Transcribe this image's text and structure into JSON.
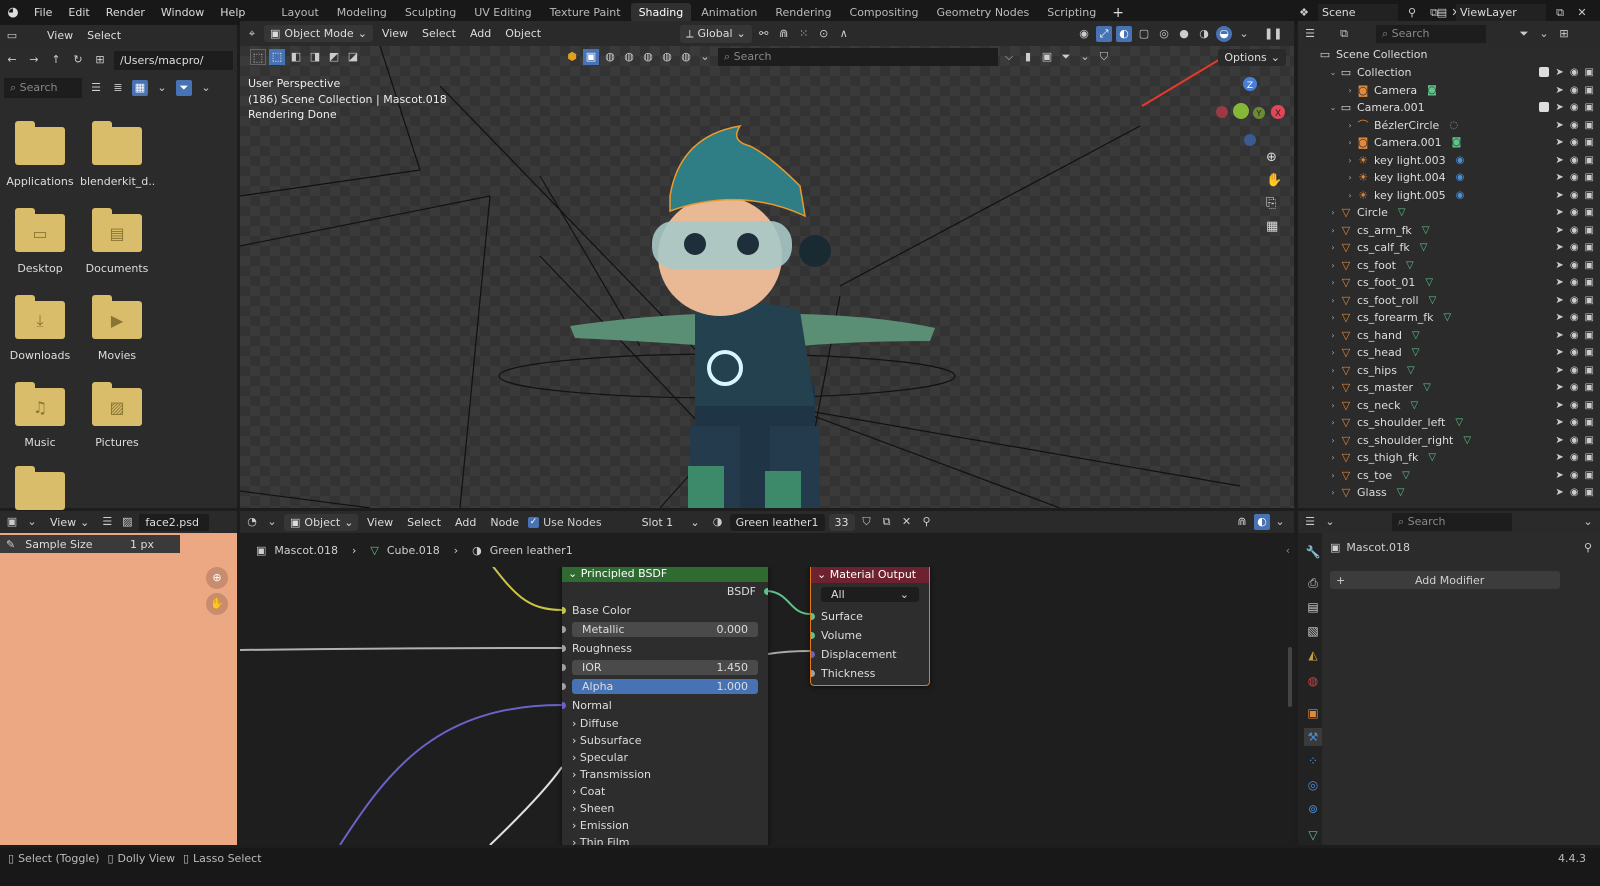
{
  "menu": {
    "file": "File",
    "edit": "Edit",
    "render": "Render",
    "window": "Window",
    "help": "Help"
  },
  "workspaces": [
    "Layout",
    "Modeling",
    "Sculpting",
    "UV Editing",
    "Texture Paint",
    "Shading",
    "Animation",
    "Rendering",
    "Compositing",
    "Geometry Nodes",
    "Scripting"
  ],
  "active_workspace": "Shading",
  "scene": {
    "name": "Scene",
    "view_layer": "ViewLayer"
  },
  "file_browser": {
    "view": "View",
    "select": "Select",
    "path": "/Users/macpro/",
    "search_placeholder": "Search",
    "items": [
      {
        "label": "Applications",
        "icon": "folder"
      },
      {
        "label": "blenderkit_d...",
        "icon": "folder"
      },
      {
        "label": "Desktop",
        "icon": "desktop"
      },
      {
        "label": "Documents",
        "icon": "documents"
      },
      {
        "label": "Downloads",
        "icon": "download"
      },
      {
        "label": "Movies",
        "icon": "film"
      },
      {
        "label": "Music",
        "icon": "music"
      },
      {
        "label": "Pictures",
        "icon": "picture"
      }
    ]
  },
  "viewport": {
    "mode": "Object Mode",
    "view": "View",
    "select": "Select",
    "add": "Add",
    "object": "Object",
    "transform": "Global",
    "search_placeholder": "Search",
    "options": "Options",
    "overlay_line1": "User Perspective",
    "overlay_line2": "(186) Scene Collection | Mascot.018",
    "overlay_line3": "Rendering Done",
    "gizmo": {
      "z": "Z",
      "y": "Y",
      "x": "X"
    }
  },
  "outliner": {
    "search_placeholder": "Search",
    "root": "Scene Collection",
    "rows": [
      {
        "name": "Collection",
        "indent": 1,
        "type": "collection"
      },
      {
        "name": "Camera",
        "indent": 2,
        "type": "camera"
      },
      {
        "name": "Camera.001",
        "indent": 1,
        "type": "collection"
      },
      {
        "name": "BézlerCircle",
        "indent": 2,
        "type": "curve"
      },
      {
        "name": "Camera.001",
        "indent": 2,
        "type": "camera"
      },
      {
        "name": "key light.003",
        "indent": 2,
        "type": "light"
      },
      {
        "name": "key light.004",
        "indent": 2,
        "type": "light"
      },
      {
        "name": "key light.005",
        "indent": 2,
        "type": "light"
      },
      {
        "name": "Circle",
        "indent": 1,
        "type": "mesh"
      },
      {
        "name": "cs_arm_fk",
        "indent": 1,
        "type": "mesh"
      },
      {
        "name": "cs_calf_fk",
        "indent": 1,
        "type": "mesh"
      },
      {
        "name": "cs_foot",
        "indent": 1,
        "type": "mesh"
      },
      {
        "name": "cs_foot_01",
        "indent": 1,
        "type": "mesh"
      },
      {
        "name": "cs_foot_roll",
        "indent": 1,
        "type": "mesh"
      },
      {
        "name": "cs_forearm_fk",
        "indent": 1,
        "type": "mesh"
      },
      {
        "name": "cs_hand",
        "indent": 1,
        "type": "mesh"
      },
      {
        "name": "cs_head",
        "indent": 1,
        "type": "mesh"
      },
      {
        "name": "cs_hips",
        "indent": 1,
        "type": "mesh"
      },
      {
        "name": "cs_master",
        "indent": 1,
        "type": "mesh"
      },
      {
        "name": "cs_neck",
        "indent": 1,
        "type": "mesh"
      },
      {
        "name": "cs_shoulder_left",
        "indent": 1,
        "type": "mesh"
      },
      {
        "name": "cs_shoulder_right",
        "indent": 1,
        "type": "mesh"
      },
      {
        "name": "cs_thigh_fk",
        "indent": 1,
        "type": "mesh"
      },
      {
        "name": "cs_toe",
        "indent": 1,
        "type": "mesh"
      },
      {
        "name": "Glass",
        "indent": 1,
        "type": "mesh"
      }
    ]
  },
  "image_editor": {
    "view": "View",
    "image": "face2.psd",
    "sample_label": "Sample Size",
    "sample_value": "1 px",
    "color": "#eba882"
  },
  "node_editor": {
    "object": "Object",
    "view": "View",
    "select": "Select",
    "add": "Add",
    "node": "Node",
    "use_nodes": "Use Nodes",
    "slot": "Slot 1",
    "material": "Green leather1",
    "users": "33",
    "breadcrumb": [
      "Mascot.018",
      "Cube.018",
      "Green leather1"
    ],
    "bsdf": {
      "title": "Principled BSDF",
      "output": "BSDF",
      "base_color": "Base Color",
      "metallic": "Metallic",
      "metallic_value": "0.000",
      "roughness": "Roughness",
      "ior": "IOR",
      "ior_value": "1.450",
      "alpha": "Alpha",
      "alpha_value": "1.000",
      "normal": "Normal",
      "panels": [
        "Diffuse",
        "Subsurface",
        "Specular",
        "Transmission",
        "Coat",
        "Sheen",
        "Emission",
        "Thin Film"
      ]
    },
    "output": {
      "title": "Material Output",
      "target": "All",
      "surface": "Surface",
      "volume": "Volume",
      "displacement": "Displacement",
      "thickness": "Thickness"
    }
  },
  "properties": {
    "search_placeholder": "Search",
    "object": "Mascot.018",
    "add_modifier": "Add Modifier"
  },
  "status": {
    "select": "Select (Toggle)",
    "dolly": "Dolly View",
    "lasso": "Lasso Select",
    "version": "4.4.3"
  }
}
